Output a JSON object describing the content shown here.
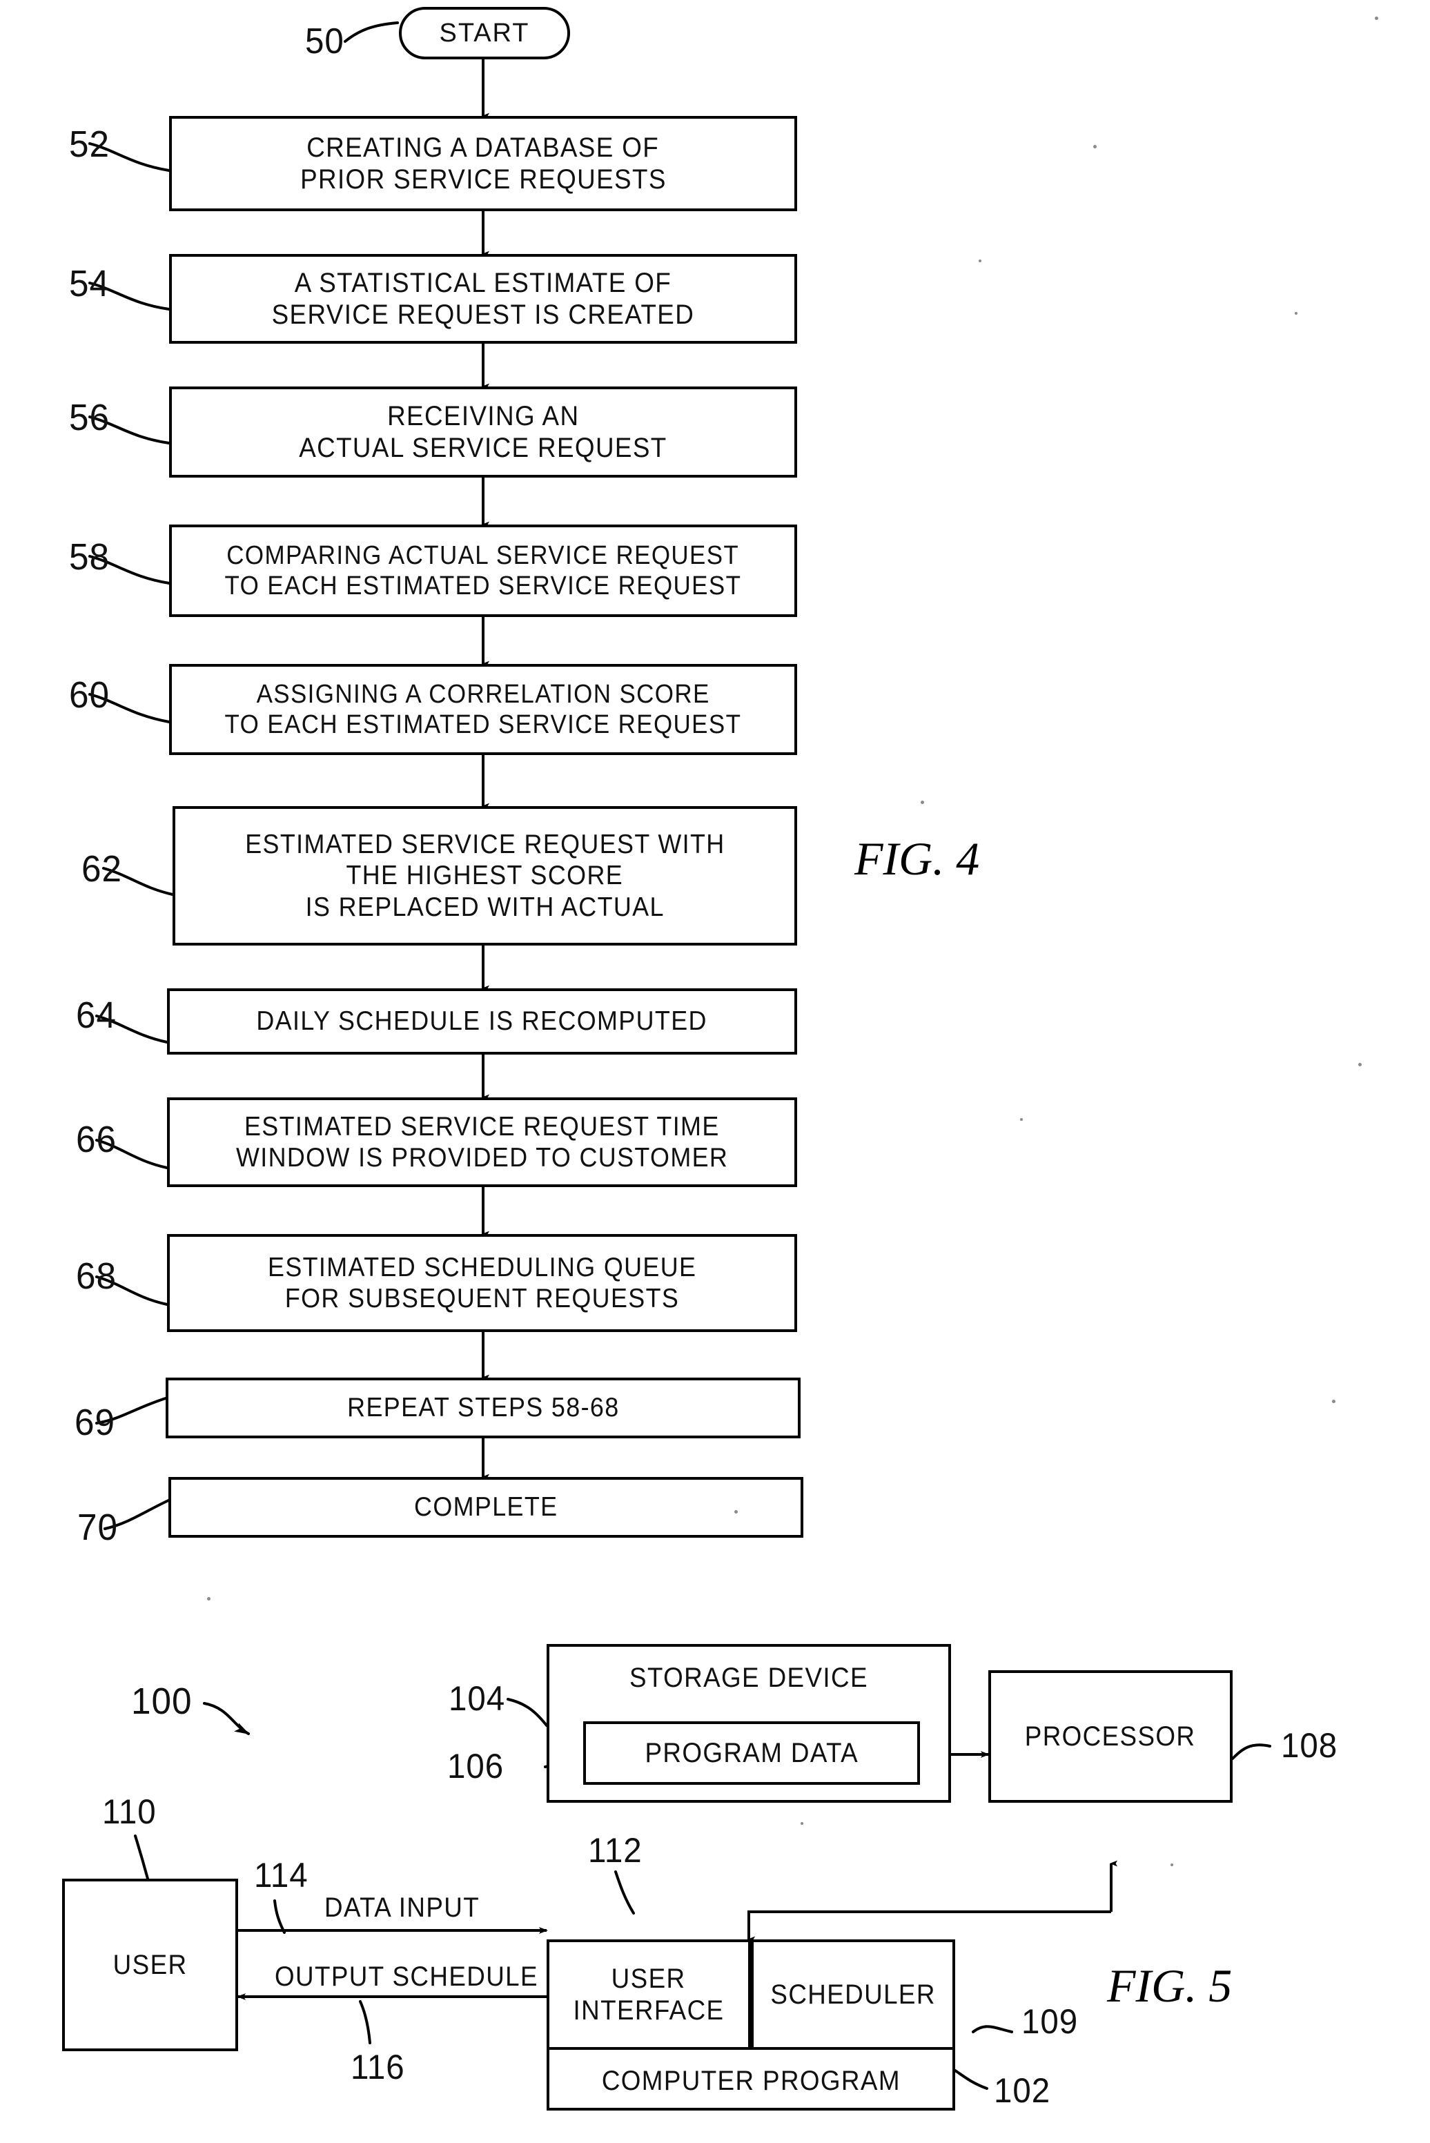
{
  "figure4": {
    "caption": "FIG.   4",
    "start": {
      "ref": "50",
      "label": "START"
    },
    "steps": [
      {
        "ref": "52",
        "lines": [
          "CREATING A DATABASE OF",
          "PRIOR SERVICE REQUESTS"
        ]
      },
      {
        "ref": "54",
        "lines": [
          "A STATISTICAL ESTIMATE OF",
          "SERVICE REQUEST IS CREATED"
        ]
      },
      {
        "ref": "56",
        "lines": [
          "RECEIVING AN",
          "ACTUAL SERVICE REQUEST"
        ]
      },
      {
        "ref": "58",
        "lines": [
          "COMPARING ACTUAL SERVICE REQUEST",
          "TO EACH ESTIMATED SERVICE REQUEST"
        ]
      },
      {
        "ref": "60",
        "lines": [
          "ASSIGNING A CORRELATION SCORE",
          "TO EACH ESTIMATED SERVICE REQUEST"
        ]
      },
      {
        "ref": "62",
        "lines": [
          "ESTIMATED SERVICE REQUEST WITH",
          "THE HIGHEST SCORE",
          "IS REPLACED WITH ACTUAL"
        ]
      },
      {
        "ref": "64",
        "lines": [
          "DAILY SCHEDULE IS RECOMPUTED"
        ]
      },
      {
        "ref": "66",
        "lines": [
          "ESTIMATED SERVICE REQUEST TIME",
          "WINDOW IS PROVIDED TO CUSTOMER"
        ]
      },
      {
        "ref": "68",
        "lines": [
          "ESTIMATED SCHEDULING QUEUE",
          "FOR SUBSEQUENT REQUESTS"
        ]
      },
      {
        "ref": "69",
        "lines": [
          "REPEAT STEPS 58-68"
        ]
      },
      {
        "ref": "70",
        "lines": [
          "COMPLETE"
        ]
      }
    ]
  },
  "figure5": {
    "caption": "FIG.   5",
    "system_ref": "100",
    "blocks": {
      "storage_device": {
        "ref": "104",
        "label": "STORAGE DEVICE"
      },
      "program_data": {
        "ref": "106",
        "label": "PROGRAM DATA"
      },
      "processor": {
        "ref": "108",
        "label": "PROCESSOR"
      },
      "user": {
        "ref": "110",
        "label": "USER"
      },
      "user_interface": {
        "ref": "112",
        "lines": [
          "USER",
          "INTERFACE"
        ]
      },
      "scheduler": {
        "ref": "109",
        "label": "SCHEDULER"
      },
      "computer_program": {
        "ref": "102",
        "label": "COMPUTER PROGRAM"
      }
    },
    "edges": {
      "data_input": {
        "ref": "114",
        "label": "DATA INPUT"
      },
      "output_schedule": {
        "ref": "116",
        "label": "OUTPUT SCHEDULE"
      }
    }
  }
}
